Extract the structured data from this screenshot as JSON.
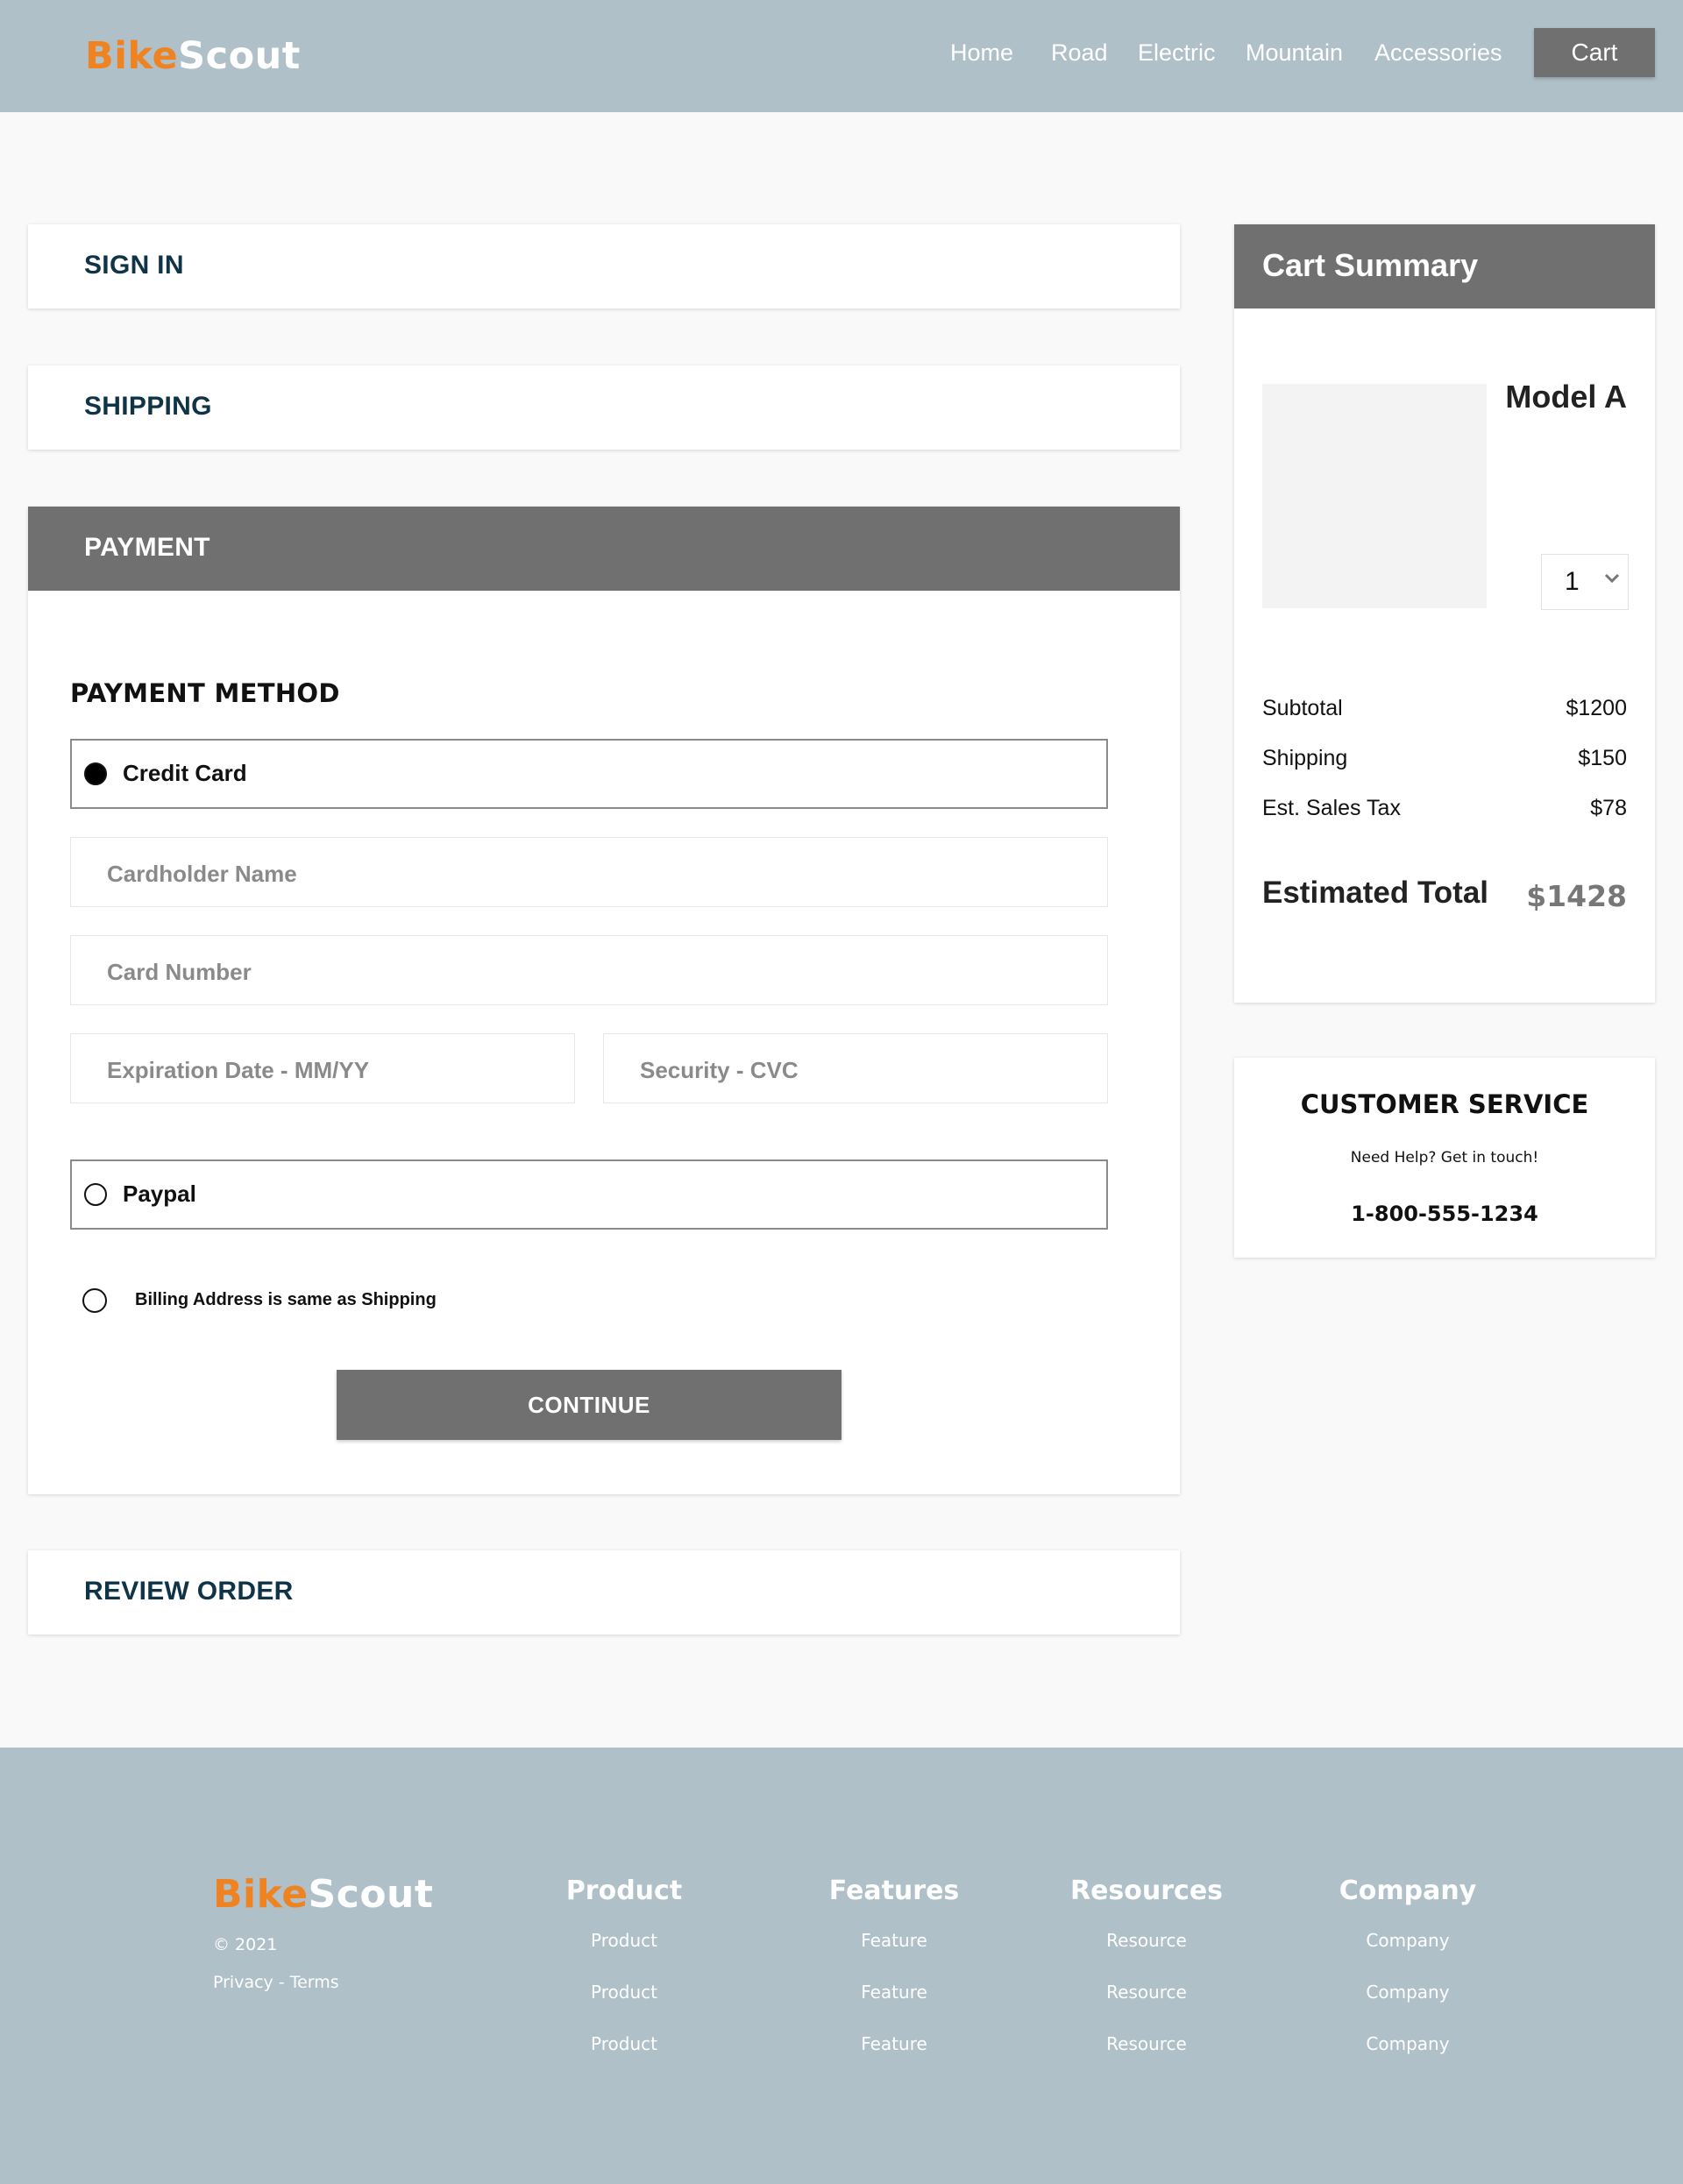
{
  "brand": {
    "part1": "Bike",
    "part2": "Scout",
    "accent_color": "#ef8322"
  },
  "nav": {
    "links": [
      "Home",
      "Road",
      "Electric",
      "Mountain",
      "Accessories"
    ],
    "cart_label": "Cart"
  },
  "checkout": {
    "sign_in_title": "SIGN IN",
    "shipping_title": "SHIPPING",
    "payment_title": "PAYMENT",
    "review_title": "REVIEW ORDER",
    "payment_method_title": "PAYMENT METHOD",
    "credit_card_label": "Credit Card",
    "credit_card_selected": true,
    "cardholder_placeholder": "Cardholder Name",
    "card_number_placeholder": "Card Number",
    "expiration_placeholder": "Expiration Date - MM/YY",
    "security_placeholder": "Security - CVC",
    "paypal_label": "Paypal",
    "billing_label": "Billing Address is same as Shipping",
    "continue_label": "CONTINUE"
  },
  "cart_summary": {
    "title": "Cart Summary",
    "item_name": "Model A",
    "quantity": "1",
    "lines": [
      {
        "label": "Subtotal",
        "value": "$1200"
      },
      {
        "label": "Shipping",
        "value": "$150"
      },
      {
        "label": "Est. Sales Tax",
        "value": "$78"
      }
    ],
    "total_label": "Estimated Total",
    "total_value": "$1428"
  },
  "customer_service": {
    "title": "CUSTOMER SERVICE",
    "subtitle": "Need Help? Get in touch!",
    "phone": "1-800-555-1234"
  },
  "footer": {
    "copyright": "© 2021",
    "legal": "Privacy - Terms",
    "columns": [
      {
        "title": "Product",
        "items": [
          "Product",
          "Product",
          "Product"
        ]
      },
      {
        "title": "Features",
        "items": [
          "Feature",
          "Feature",
          "Feature"
        ]
      },
      {
        "title": "Resources",
        "items": [
          "Resource",
          "Resource",
          "Resource"
        ]
      },
      {
        "title": "Company",
        "items": [
          "Company",
          "Company",
          "Company"
        ]
      }
    ]
  }
}
